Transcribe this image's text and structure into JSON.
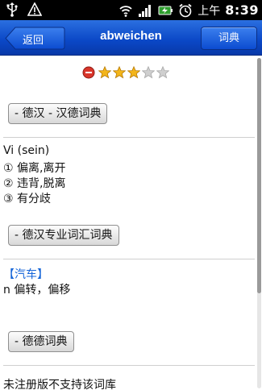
{
  "status_bar": {
    "ampm": "上午",
    "time": "8:39",
    "icons": [
      "usb-icon",
      "warning-icon",
      "wifi-icon",
      "signal-icon",
      "battery-charging-icon",
      "alarm-icon"
    ]
  },
  "titlebar": {
    "back_label": "返回",
    "title": "abweichen",
    "dict_label": "词典"
  },
  "rating": {
    "stars_filled": 3,
    "stars_total": 5
  },
  "sections": [
    {
      "button_label": "- 德汉 - 汉德词典",
      "lines": [
        "Vi (sein)",
        "① 偏离,离开",
        "② 违背,脱离",
        "③ 有分歧"
      ]
    },
    {
      "button_label": "- 德汉专业词汇词典",
      "category": "【汽车】",
      "lines": [
        "n 偏转，偏移"
      ]
    },
    {
      "button_label": "- 德德词典",
      "lines": [
        "未注册版不支持该词库"
      ]
    }
  ],
  "colors": {
    "titlebar": "#0a47c6",
    "category": "#1565d8"
  }
}
